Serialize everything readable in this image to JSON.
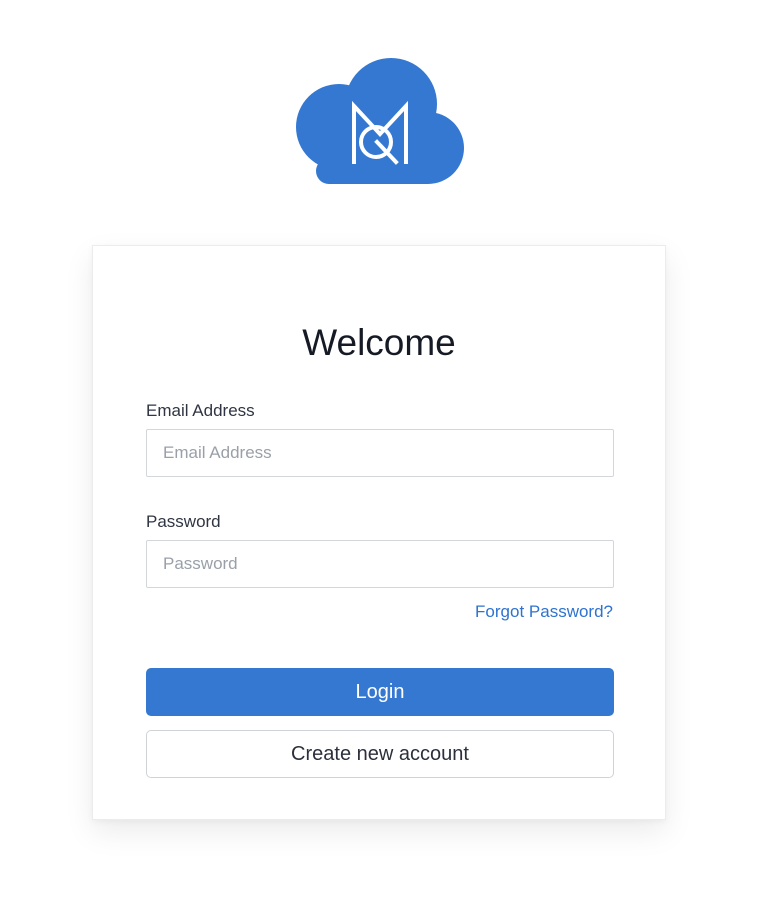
{
  "brand": {
    "logo_icon": "cloud-mq-logo-icon",
    "color": "#3478d1"
  },
  "login_form": {
    "title": "Welcome",
    "email_label": "Email Address",
    "email_placeholder": "Email Address",
    "email_value": "",
    "password_label": "Password",
    "password_placeholder": "Password",
    "password_value": "",
    "forgot_password_link": "Forgot Password?",
    "login_button": "Login",
    "create_account_button": "Create new account"
  },
  "colors": {
    "accent": "#3478d1",
    "link": "#2f73cf",
    "text": "#151a24"
  }
}
